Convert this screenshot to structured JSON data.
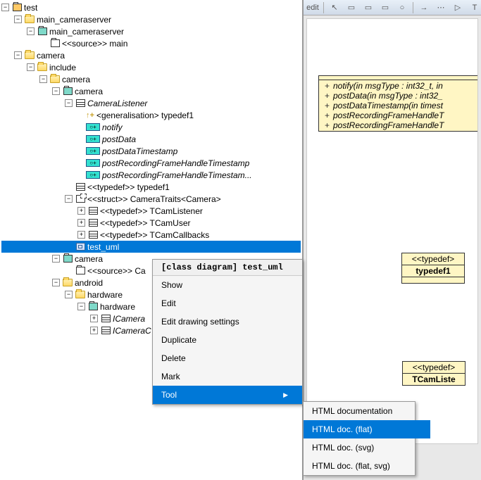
{
  "tree": {
    "root": "test",
    "main_cameraserver": "main_cameraserver",
    "main_cameraserver_pkg": "main_cameraserver",
    "source_main": "<<source>> main",
    "camera": "camera",
    "include": "include",
    "camera2": "camera",
    "camera_cls": "camera",
    "cam_listener": "CameraListener",
    "gen": "<generalisation> typedef1",
    "notify": "notify",
    "postData": "postData",
    "postDataTimestamp": "postDataTimestamp",
    "postRec1": "postRecordingFrameHandleTimestamp",
    "postRec2": "postRecordingFrameHandleTimestam...",
    "typedef1": "<<typedef>> typedef1",
    "struct_traits": "<<struct>> CameraTraits<Camera>",
    "tcam_listener": "<<typedef>> TCamListener",
    "tcam_user": "<<typedef>> TCamUser",
    "tcam_callbacks": "<<typedef>> TCamCallbacks",
    "test_uml": "test_uml",
    "camera_pkg2": "camera",
    "source_ca": "<<source>> Ca",
    "android": "android",
    "hardware": "hardware",
    "hardware_pkg": "hardware",
    "icamera": "ICamera",
    "icamerac": "ICameraC"
  },
  "menu1": {
    "title": "[class diagram] test_uml",
    "items": [
      "Show",
      "Edit",
      "Edit drawing settings",
      "Duplicate",
      "Delete",
      "Mark",
      "Tool"
    ]
  },
  "menu2": {
    "items": [
      "HTML documentation",
      "HTML doc. (flat)",
      "HTML doc. (svg)",
      "HTML doc. (flat, svg)"
    ]
  },
  "toolbar": {
    "edit": "edit"
  },
  "uml": {
    "box1": {
      "ops": [
        "notify(in msgType : int32_t, in",
        "postData(in msgType : int32_",
        "postDataTimestamp(in timest",
        "postRecordingFrameHandleT",
        "postRecordingFrameHandleT"
      ]
    },
    "box2": {
      "stereo": "<<typedef>",
      "name": "typedef1"
    },
    "box3": {
      "stereo": "<<typedef>",
      "name": "TCamListe"
    }
  }
}
